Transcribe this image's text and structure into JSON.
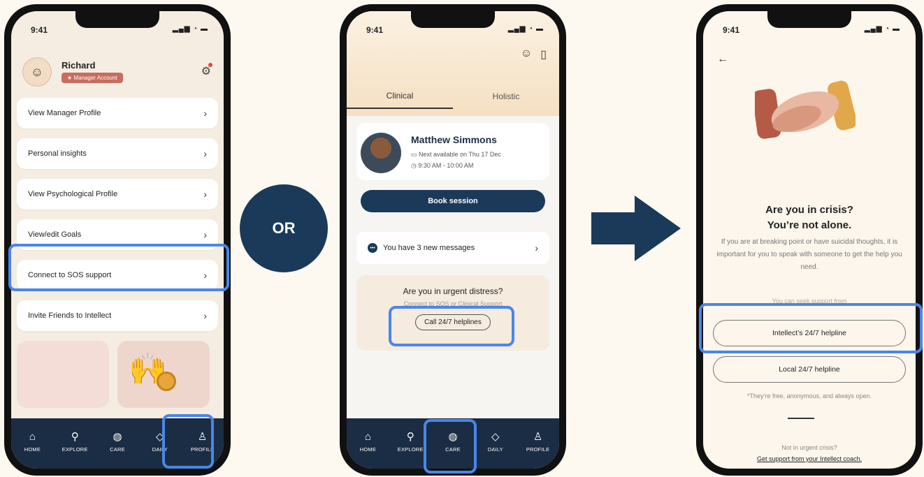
{
  "status_time": "9:41",
  "status_icons": "▂▄▆ ◔ ▬",
  "phone1": {
    "user_name": "Richard",
    "badge": "★ Manager Account",
    "menu": [
      {
        "label": "View Manager Profile"
      },
      {
        "label": "Personal insights"
      },
      {
        "label": "View Psychological Profile"
      },
      {
        "label": "View/edit Goals"
      },
      {
        "label": "Connect to SOS support"
      },
      {
        "label": "Invite Friends to Intellect"
      }
    ]
  },
  "or_label": "OR",
  "phone2": {
    "tab_clinical": "Clinical",
    "tab_holistic": "Holistic",
    "doctor_name": "Matthew Simmons",
    "next_available": "Next available on Thu 17 Dec",
    "time_slot": "9:30 AM - 10:00 AM",
    "book_label": "Book session",
    "messages_text": "You have 3 new messages",
    "urgent_title": "Are you in urgent distress?",
    "urgent_sub": "Connect to SOS or Clinical Support",
    "helpline_label": "Call 24/7 helplines"
  },
  "phone3": {
    "title_line1": "Are you in crisis?",
    "title_line2": "You’re not alone.",
    "body": "If you are at breaking point or have suicidal thoughts, it is important for you to speak with someone to get the help you need.",
    "seek_text": "You can seek support from",
    "intellect_helpline": "Intellect’s 24/7 helpline",
    "local_helpline": "Local 24/7 helpline",
    "free_note": "*They’re free, anonymous, and always open.",
    "not_urgent": "Not in urgent crisis?",
    "coach_link": "Get support from your Intellect coach."
  },
  "tabbar": {
    "home": "HOME",
    "explore": "EXPLORE",
    "care": "CARE",
    "daily": "DAILY",
    "profile": "PROFILE"
  },
  "colors": {
    "navy": "#1b3a59",
    "highlight": "#4a86e8",
    "badge": "#c96c5e"
  }
}
